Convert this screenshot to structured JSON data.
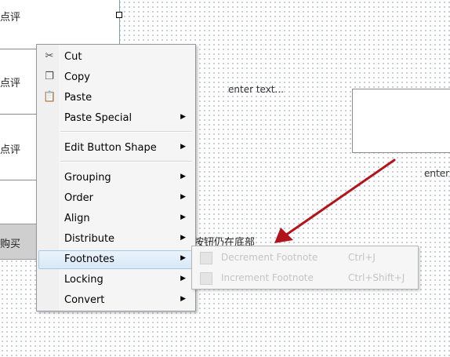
{
  "left_panel": {
    "rows": [
      "点评",
      "点评",
      "点评"
    ],
    "buy_label": "购买"
  },
  "canvas": {
    "enter_text_1": "enter text...",
    "enter_text_2": "enter",
    "bottom_text": "按钮仍在底部"
  },
  "context_menu": {
    "items": [
      {
        "label": "Cut",
        "icon": "scissors-icon",
        "submenu": false
      },
      {
        "label": "Copy",
        "icon": "copy-icon",
        "submenu": false
      },
      {
        "label": "Paste",
        "icon": "paste-icon",
        "submenu": false
      },
      {
        "label": "Paste Special",
        "submenu": true
      },
      {
        "label": "Edit Button Shape",
        "submenu": true
      },
      {
        "label": "Grouping",
        "submenu": true
      },
      {
        "label": "Order",
        "submenu": true
      },
      {
        "label": "Align",
        "submenu": true
      },
      {
        "label": "Distribute",
        "submenu": true
      },
      {
        "label": "Footnotes",
        "submenu": true,
        "highlighted": true
      },
      {
        "label": "Locking",
        "submenu": true
      },
      {
        "label": "Convert",
        "submenu": true
      }
    ]
  },
  "footnotes_submenu": {
    "items": [
      {
        "label": "Decrement Footnote",
        "shortcut": "Ctrl+J",
        "enabled": false
      },
      {
        "label": "Increment Footnote",
        "shortcut": "Ctrl+Shift+J",
        "enabled": false
      }
    ]
  },
  "colors": {
    "arrow": "#b3141b",
    "highlight": "#d8e9f8"
  }
}
